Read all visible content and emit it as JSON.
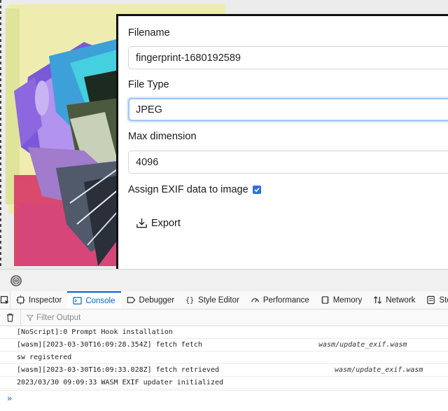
{
  "dialog": {
    "filename_label": "Filename",
    "filename_value": "fingerprint-1680192589",
    "filetype_label": "File Type",
    "filetype_value": "JPEG",
    "maxdim_label": "Max dimension",
    "maxdim_value": "4096",
    "exif_label": "Assign EXIF data to image",
    "exif_checked": true,
    "export_label": "Export"
  },
  "devtools": {
    "tabs": [
      {
        "label": "Inspector",
        "icon": "inspector-icon"
      },
      {
        "label": "Console",
        "icon": "console-icon",
        "active": true
      },
      {
        "label": "Debugger",
        "icon": "debugger-icon"
      },
      {
        "label": "Style Editor",
        "icon": "style-editor-icon"
      },
      {
        "label": "Performance",
        "icon": "performance-icon"
      },
      {
        "label": "Memory",
        "icon": "memory-icon"
      },
      {
        "label": "Network",
        "icon": "network-icon"
      },
      {
        "label": "Stor",
        "icon": "storage-icon"
      }
    ],
    "filter_placeholder": "Filter Output",
    "console_lines": [
      {
        "text": "[NoScript]:0 Prompt Hook installation",
        "source": ""
      },
      {
        "text": "[wasm][2023-03-30T16:09:28.354Z] fetch fetch",
        "source": "wasm/update_exif.wasm"
      },
      {
        "text": "sw registered",
        "source": ""
      },
      {
        "text": "[wasm][2023-03-30T16:09:33.028Z] fetch retrieved",
        "source": "wasm/update_exif.wasm"
      },
      {
        "text": "2023/03/30 09:09:33 WASM EXIF updater initialized",
        "source": ""
      }
    ],
    "prompt_glyph": "»"
  },
  "colors": {
    "accent": "#0a63c9",
    "checkbox": "#2f6fde"
  }
}
